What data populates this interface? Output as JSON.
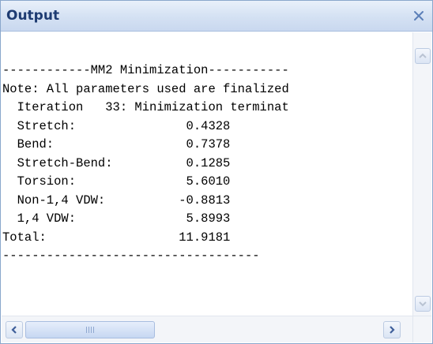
{
  "window": {
    "title": "Output",
    "close_glyph": "×"
  },
  "output": {
    "lines": [
      "------------MM2 Minimization-----------",
      "Note: All parameters used are finalized",
      "  Iteration   33: Minimization terminat",
      "  Stretch:               0.4328",
      "  Bend:                  0.7378",
      "  Stretch-Bend:          0.1285",
      "  Torsion:               5.6010",
      "  Non-1,4 VDW:          -0.8813",
      "  1,4 VDW:               5.8993",
      "Total:                  11.9181",
      "-----------------------------------"
    ]
  },
  "scrollbars": {
    "vertical": {
      "up_icon": "chevron-up-icon",
      "down_icon": "chevron-down-icon"
    },
    "horizontal": {
      "left_icon": "chevron-left-icon",
      "right_icon": "chevron-right-icon",
      "thumb_position": 0.0
    }
  },
  "colors": {
    "title_text": "#1e3c72",
    "title_bar": "#d4e1f3",
    "close_icon": "#5b7fb8",
    "scroll_arrow_blue": "#3f5f9a",
    "scroll_arrow_gray": "#b9c3d3"
  }
}
